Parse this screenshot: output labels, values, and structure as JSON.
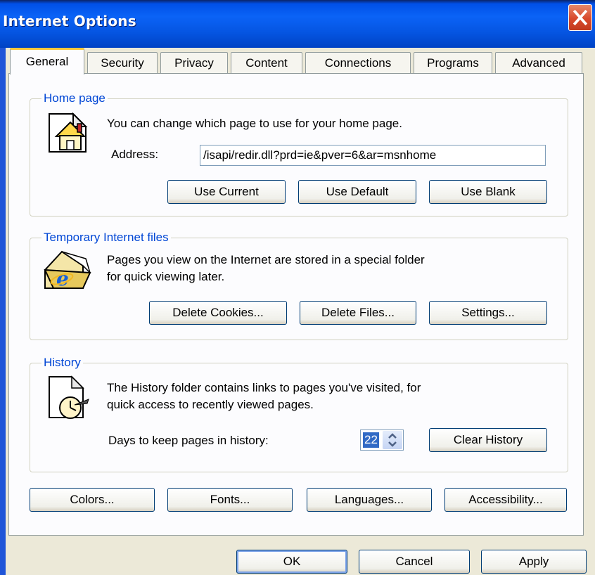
{
  "window": {
    "title": "Internet Options"
  },
  "tabs": [
    {
      "label": "General",
      "active": true
    },
    {
      "label": "Security"
    },
    {
      "label": "Privacy"
    },
    {
      "label": "Content"
    },
    {
      "label": "Connections"
    },
    {
      "label": "Programs"
    },
    {
      "label": "Advanced"
    }
  ],
  "home_page": {
    "legend": "Home page",
    "description": "You can change which page to use for your home page.",
    "address_label": "Address:",
    "address_value": "⁠/isapi/redir.dll?prd=ie&pver=6&ar=msnhome",
    "use_current": "Use Current",
    "use_default": "Use Default",
    "use_blank": "Use Blank",
    "icon": "home-page-icon"
  },
  "temp_files": {
    "legend": "Temporary Internet files",
    "line1": "Pages you view on the Internet are stored in a special folder",
    "line2": "for quick viewing later.",
    "delete_cookies": "Delete Cookies...",
    "delete_files": "Delete Files...",
    "settings": "Settings...",
    "icon": "temporary-files-folder-icon"
  },
  "history": {
    "legend": "History",
    "line1": "The History folder contains links to pages you've visited, for",
    "line2": "quick access to recently viewed pages.",
    "days_label": "Days to keep pages in history:",
    "days_value": "22",
    "clear_history": "Clear History",
    "icon": "history-icon"
  },
  "bottom_buttons": {
    "colors": "Colors...",
    "fonts": "Fonts...",
    "languages": "Languages...",
    "accessibility": "Accessibility..."
  },
  "dialog_buttons": {
    "ok": "OK",
    "cancel": "Cancel",
    "apply": "Apply"
  },
  "colors": {
    "title_bar": "#0554e0",
    "panel": "#fcfcfe",
    "dialog": "#ece9d8",
    "legend": "#0046d5",
    "active_tab_accent": "#ffc83c",
    "close_button": "#d8492c"
  }
}
